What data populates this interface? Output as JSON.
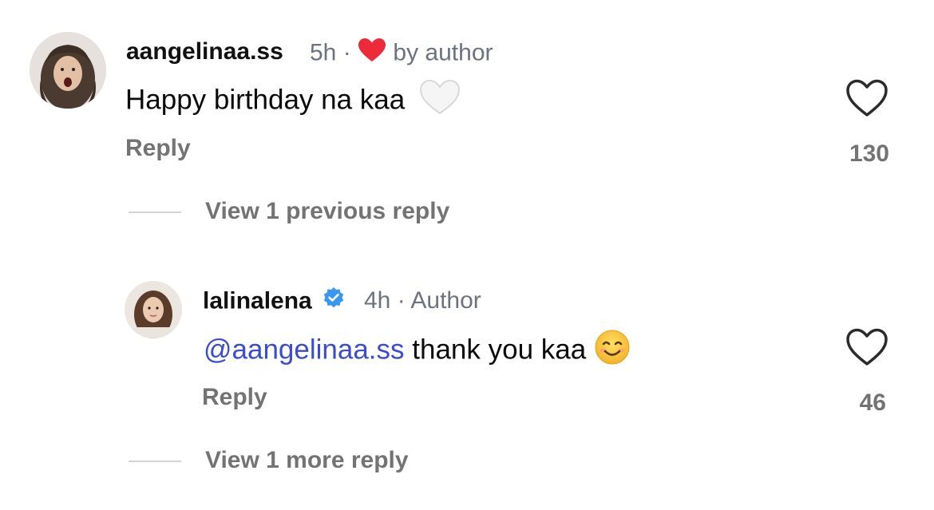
{
  "comments": [
    {
      "username": "aangelinaa.ss",
      "time": "5h",
      "separator": "·",
      "badge": "by author",
      "badge_icon": "red-heart-icon",
      "text": "Happy birthday na kaa",
      "text_emoji": "white-heart-emoji",
      "reply_label": "Reply",
      "like_count": "130",
      "view_replies": "View 1 previous reply"
    },
    {
      "username": "lalinalena",
      "verified_icon": "verified-badge-icon",
      "time": "4h",
      "separator": "·",
      "badge": "Author",
      "mention": "@aangelinaa.ss",
      "text": " thank you kaa",
      "text_emoji": "smiling-face-emoji",
      "reply_label": "Reply",
      "like_count": "46",
      "view_replies": "View 1 more reply"
    }
  ],
  "colors": {
    "mention": "#3b4ccf",
    "heart_red": "#ed2a3a",
    "verified_blue": "#3897f0",
    "muted_text": "#737373"
  }
}
